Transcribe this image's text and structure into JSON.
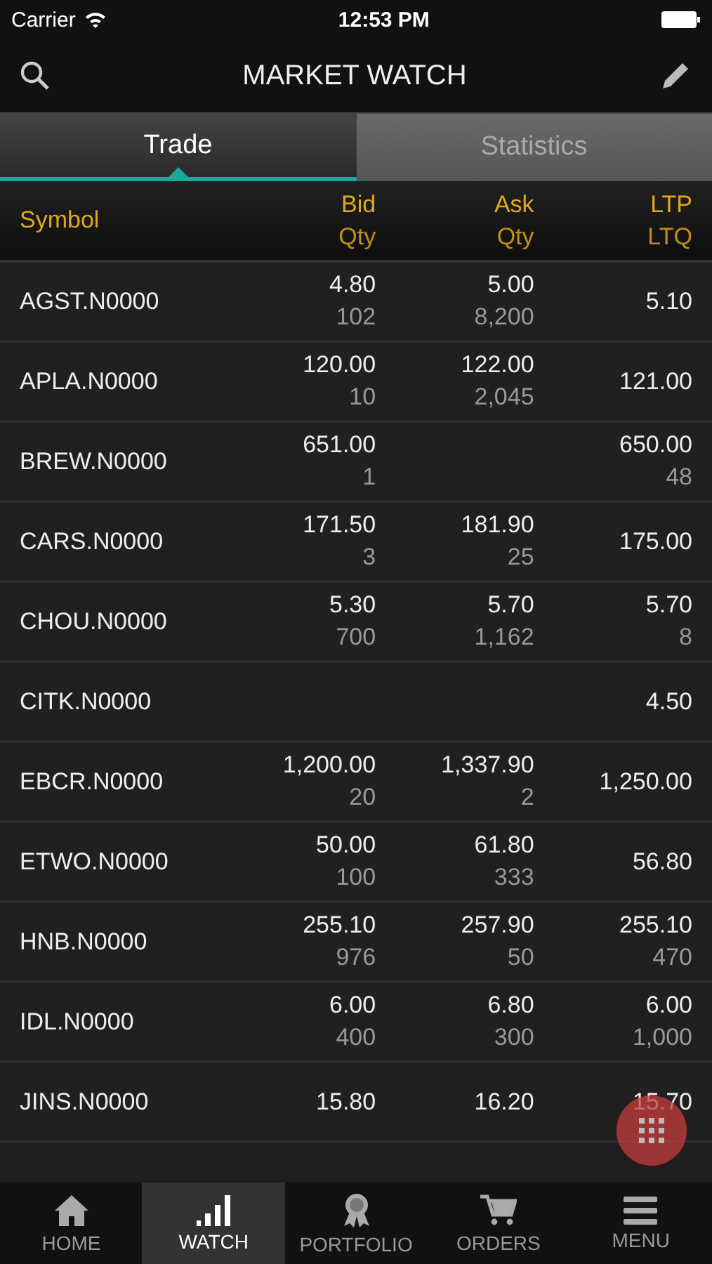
{
  "status_bar": {
    "carrier": "Carrier",
    "time": "12:53 PM"
  },
  "nav": {
    "title": "MARKET WATCH"
  },
  "tabs": [
    {
      "label": "Trade",
      "selected": true
    },
    {
      "label": "Statistics",
      "selected": false
    }
  ],
  "columns": {
    "symbol": "Symbol",
    "bid": "Bid",
    "bid_qty": "Qty",
    "ask": "Ask",
    "ask_qty": "Qty",
    "ltp": "LTP",
    "ltq": "LTQ"
  },
  "rows": [
    {
      "symbol": "AGST.N0000",
      "bid": "4.80",
      "bid_qty": "102",
      "ask": "5.00",
      "ask_qty": "8,200",
      "ltp": "5.10"
    },
    {
      "symbol": "APLA.N0000",
      "bid": "120.00",
      "bid_qty": "10",
      "ask": "122.00",
      "ask_qty": "2,045",
      "ltp": "121.00"
    },
    {
      "symbol": "BREW.N0000",
      "bid": "651.00",
      "bid_qty": "1",
      "ltp": "650.00",
      "ltq": "48"
    },
    {
      "symbol": "CARS.N0000",
      "bid": "171.50",
      "bid_qty": "3",
      "ask": "181.90",
      "ask_qty": "25",
      "ltp": "175.00"
    },
    {
      "symbol": "CHOU.N0000",
      "bid": "5.30",
      "bid_qty": "700",
      "ask": "5.70",
      "ask_qty": "1,162",
      "ltp": "5.70",
      "ltq": "8"
    },
    {
      "symbol": "CITK.N0000",
      "ltp": "4.50"
    },
    {
      "symbol": "EBCR.N0000",
      "bid": "1,200.00",
      "bid_qty": "20",
      "ask": "1,337.90",
      "ask_qty": "2",
      "ltp": "1,250.00"
    },
    {
      "symbol": "ETWO.N0000",
      "bid": "50.00",
      "bid_qty": "100",
      "ask": "61.80",
      "ask_qty": "333",
      "ltp": "56.80"
    },
    {
      "symbol": "HNB.N0000",
      "bid": "255.10",
      "bid_qty": "976",
      "ask": "257.90",
      "ask_qty": "50",
      "ltp": "255.10",
      "ltq": "470"
    },
    {
      "symbol": "IDL.N0000",
      "bid": "6.00",
      "bid_qty": "400",
      "ask": "6.80",
      "ask_qty": "300",
      "ltp": "6.00",
      "ltq": "1,000"
    },
    {
      "symbol": "JINS.N0000",
      "bid": "15.80",
      "ask": "16.20",
      "ltp": "15.70"
    }
  ],
  "bottom_nav": [
    {
      "label": "HOME",
      "kind": "home",
      "selected": false
    },
    {
      "label": "WATCH",
      "kind": "watch",
      "selected": true
    },
    {
      "label": "PORTFOLIO",
      "kind": "portfolio",
      "selected": false
    },
    {
      "label": "ORDERS",
      "kind": "orders",
      "selected": false
    },
    {
      "label": "MENU",
      "kind": "menu",
      "selected": false
    }
  ]
}
